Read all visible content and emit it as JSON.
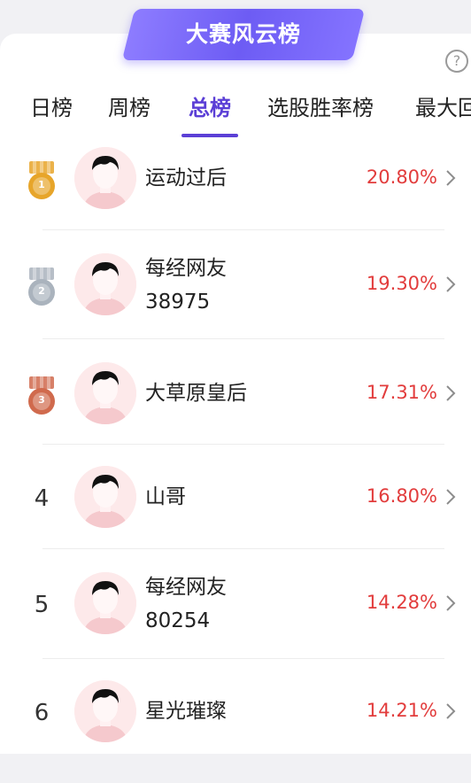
{
  "banner": {
    "title": "大赛风云榜"
  },
  "help": {
    "label": "?"
  },
  "tabs": [
    {
      "label": "日榜"
    },
    {
      "label": "周榜"
    },
    {
      "label": "总榜"
    },
    {
      "label": "选股胜率榜"
    },
    {
      "label": "最大回"
    }
  ],
  "active_tab": "总榜",
  "rows": [
    {
      "rank": "1",
      "name1": "运动过后",
      "name2": "",
      "pct": "20.80%"
    },
    {
      "rank": "2",
      "name1": "每经网友",
      "name2": "38975",
      "pct": "19.30%"
    },
    {
      "rank": "3",
      "name1": "大草原皇后",
      "name2": "",
      "pct": "17.31%"
    },
    {
      "rank": "4",
      "name1": "山哥",
      "name2": "",
      "pct": "16.80%"
    },
    {
      "rank": "5",
      "name1": "每经网友",
      "name2": "80254",
      "pct": "14.28%"
    },
    {
      "rank": "6",
      "name1": "星光璀璨",
      "name2": "",
      "pct": "14.21%"
    }
  ],
  "colors": {
    "accent": "#5b3fd6",
    "banner": "#7a68f8",
    "pct": "#e23c3c",
    "gold": "#e7a52a",
    "silver": "#aab3bd",
    "bronze": "#d06a4d"
  }
}
